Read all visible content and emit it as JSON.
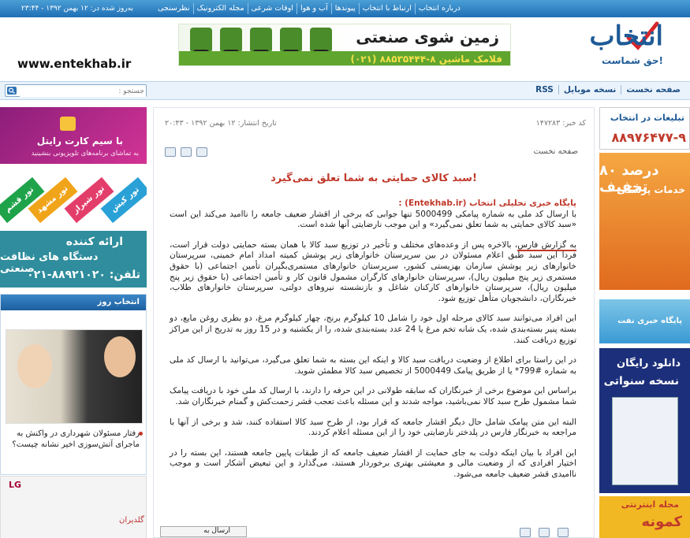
{
  "topbar": {
    "links": [
      "درباره انتخاب",
      "ارتباط با انتخاب",
      "پیوندها",
      "آب و هوا",
      "اوقات شرعی",
      "مجله الکترونیک",
      "نظرسنجی"
    ],
    "date": "به‌روز شده در: ۱۲ بهمن ۱۳۹۲ - ۲۳:۴۴"
  },
  "header": {
    "logo": "انتخاب",
    "tagline": "حق شماست!",
    "site_url": "www.entekhab.ir",
    "banner_title": "زمین شوی صنعتی",
    "banner_phone": "فلامک ماشین ۸-۸۸۵۳۵۴۴۴ (۰۲۱)"
  },
  "nav": {
    "links": [
      "صفحه نخست",
      "نسخه موبایل",
      "RSS"
    ],
    "search_placeholder": "جستجو :"
  },
  "left": {
    "ad1_title": "با سیم کارت رایتل",
    "ad1_sub": "به تماشای برنامه‌های تلویزیونی بنشینید",
    "ad2_tags": [
      "تور قشم",
      "تور مشهد",
      "تور کیش",
      "تور شیراز"
    ],
    "ad3_line1": "ارائه کننده",
    "ad3_line2": "دستگاه های نظافت صنعتی",
    "ad3_phone": "تلفن: ۸۸۹۲۱۰۲۰-۰۲۱",
    "chosen_header": "انتخاب روز",
    "chosen_caption": "رفتار مسئولان شهرداری در واکنش به ماجرای آتش‌سوزی اخیر نشانه چیست؟",
    "ad4_brand": "LG",
    "ad4_brand2": "گلدیران"
  },
  "article": {
    "news_code": "کد خبر: ۱۴۷۲۸۳",
    "publish_date": "تاریخ انتشار: ۱۲ بهمن ۱۳۹۲ - ۲۰:۴۳",
    "breadcrumb": "صفحه نخست",
    "title": "سبد کالای حمایتی به شما تعلق نمی‌گیرد!",
    "source": "پایگاه خبری تحلیلی انتخاب (Entekhab.ir) :",
    "lead": "با ارسال کد ملی به شماره پیامکی 5000499 تنها جوابی که برخی از اقشار ضعیف جامعه را ناامید می‌کند این است «سبد کالای حمایتی به شما تعلق نمی‌گیرد» و این موجب نارضایتی آنها شده است.",
    "p1_link": "به گزارش فارس",
    "p1": "، بالاخره پس از وعده‌های مختلف و تأخیر در توزیع سبد کالا با همان بسته حمایتی دولت قرار است، فردا این سبد طبق اعلام مسئولان در بین سرپرستان خانوارهای زیر پوشش کمیته امداد امام خمینی، سرپرستان خانوارهای زیر پوشش سازمان بهزیستی کشور، سرپرستان خانوارهای مستمری‌بگیران تأمین اجتماعی (با حقوق مستمری زیر پنج میلیون ریال)، سرپرستان خانوارهای کارگران مشمول قانون کار و تأمین اجتماعی (با حقوق زیر پنج میلیون ریال)، سرپرستان خانوارهای کارکنان شاغل و بازنشسته نیروهای دولتی، سرپرستان خانوارهای طلاب، خبرنگاران، دانشجویان متأهل توزیع شود.",
    "p2": "این افراد می‌توانند سبد کالای مرحله اول خود را شامل 10 کیلوگرم برنج، چهار کیلوگرم مرغ، دو بطری روغن مایع، دو بسته پنیر بسته‌بندی شده، یک شانه تخم مرغ یا 24 عدد بسته‌بندی شده، را از یکشنبه و در 15 روز به تدریج از این مراکز توزیع دریافت کنند.",
    "p3": "در این راستا برای اطلاع از وضعیت دریافت سبد کالا و اینکه این بسته به شما تعلق می‌گیرد، می‌توانید با ارسال کد ملی به شماره #799* یا از طریق پیامک 5000449 از تخصیص سبد کالا مطمئن شوید.",
    "p4": "براساس این موضوع برخی از خبرنگاران که سابقه طولانی در این حرفه را دارند، با ارسال کد ملی خود با دریافت پیامک شما مشمول طرح سبد کالا نمی‌باشید، مواجه شدند و این مسئله باعث تعجب قشر زحمت‌کش و گمنام خبرنگاران شد.",
    "p5": "البته این متن پیامک شامل حال دیگر اقشار جامعه که قرار بود، از طرح سبد کالا استفاده کنند، شد و برخی از آنها با مراجعه به خبرنگار فارس در پلدختر نارضایتی خود را از این مسئله اعلام کردند.",
    "p6": "این افراد با بیان اینکه دولت به جای حمایت از اقشار ضعیف جامعه که از طبقات پایین جامعه هستند، این بسته را در اختیار افرادی که از وضعیت مالی و معیشتی بهتری برخوردار هستند، می‌گذارد و این تبعیض آشکار است و موجب ناامیدی قشر ضعیف جامعه می‌شود.",
    "share_label": "ارسال به"
  },
  "right": {
    "r1_title": "تبلیغات در انتخاب",
    "r1_phone": "۸۸۹۷۶۴۷۷-۹",
    "r2_big": "۸۰ درصد تخفیف",
    "r2_sub": "خدمات پزشکی",
    "r3_text": "پایگاه خبری نفت",
    "r4_line1": "دانلود رایگان",
    "r4_line2": "نسخه سنواتی",
    "r5_line1": "مجله اینترنتی",
    "r5_line2": "کمونه"
  }
}
